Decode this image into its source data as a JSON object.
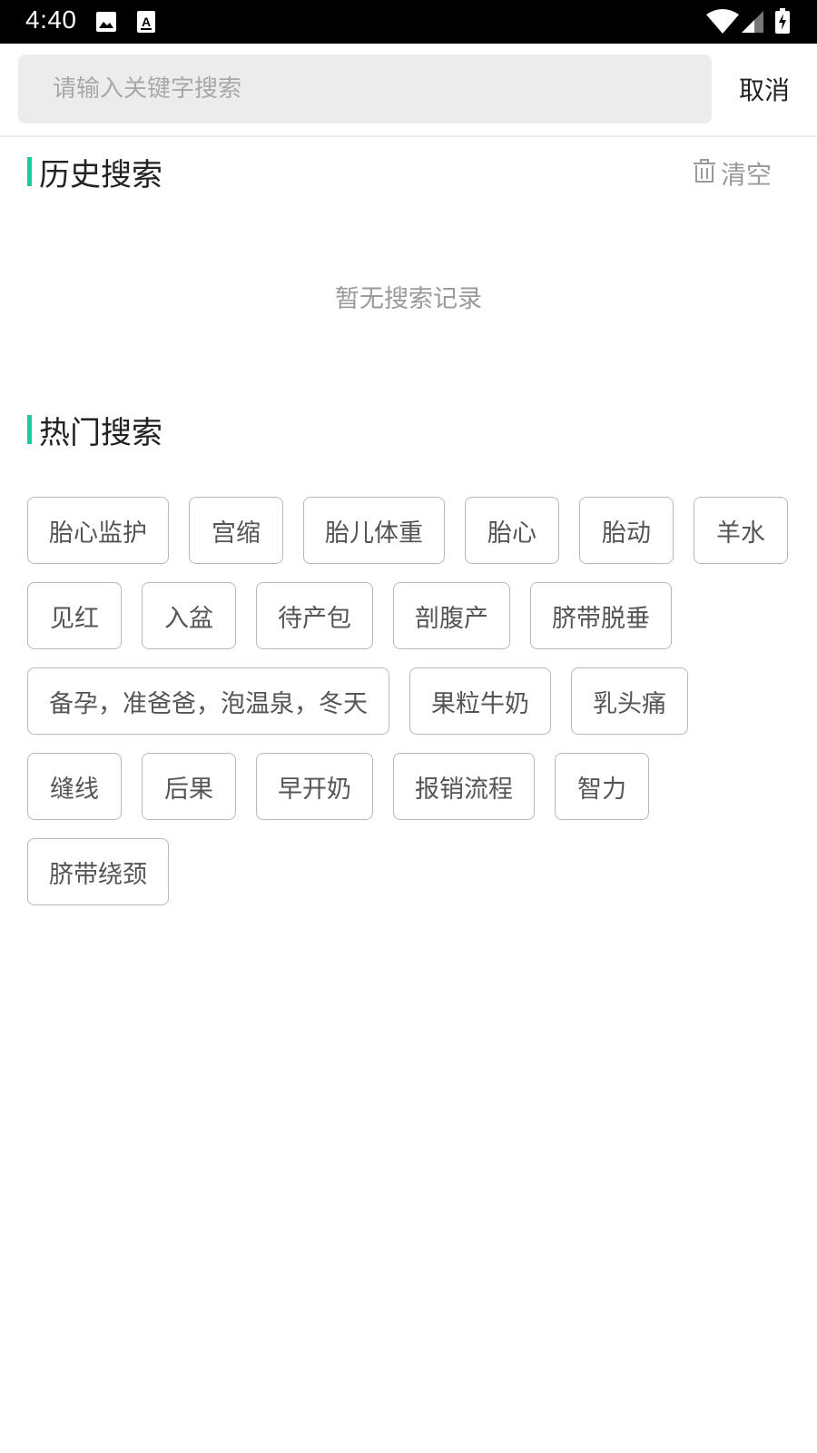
{
  "status_bar": {
    "time": "4:40",
    "icons": [
      "image-icon",
      "text-a-icon",
      "wifi-icon",
      "signal-icon",
      "battery-charging-icon"
    ]
  },
  "search": {
    "placeholder": "请输入关键字搜索",
    "cancel_label": "取消"
  },
  "history": {
    "title": "历史搜索",
    "clear_label": "清空",
    "clear_icon": "trash-icon",
    "empty_text": "暂无搜索记录"
  },
  "hot": {
    "title": "热门搜索",
    "tags": [
      "胎心监护",
      "宫缩",
      "胎儿体重",
      "胎心",
      "胎动",
      "羊水",
      "见红",
      "入盆",
      "待产包",
      "剖腹产",
      "脐带脱垂",
      "备孕，准爸爸，泡温泉，冬天",
      "果粒牛奶",
      "乳头痛",
      "缝线",
      "后果",
      "早开奶",
      "报销流程",
      "智力",
      "脐带绕颈"
    ]
  },
  "colors": {
    "accent": "#1dc9a0",
    "status_bar_bg": "#000000",
    "search_bg": "#ececec",
    "muted_text": "#9a9a9a",
    "tag_border": "#b8b8b8"
  }
}
